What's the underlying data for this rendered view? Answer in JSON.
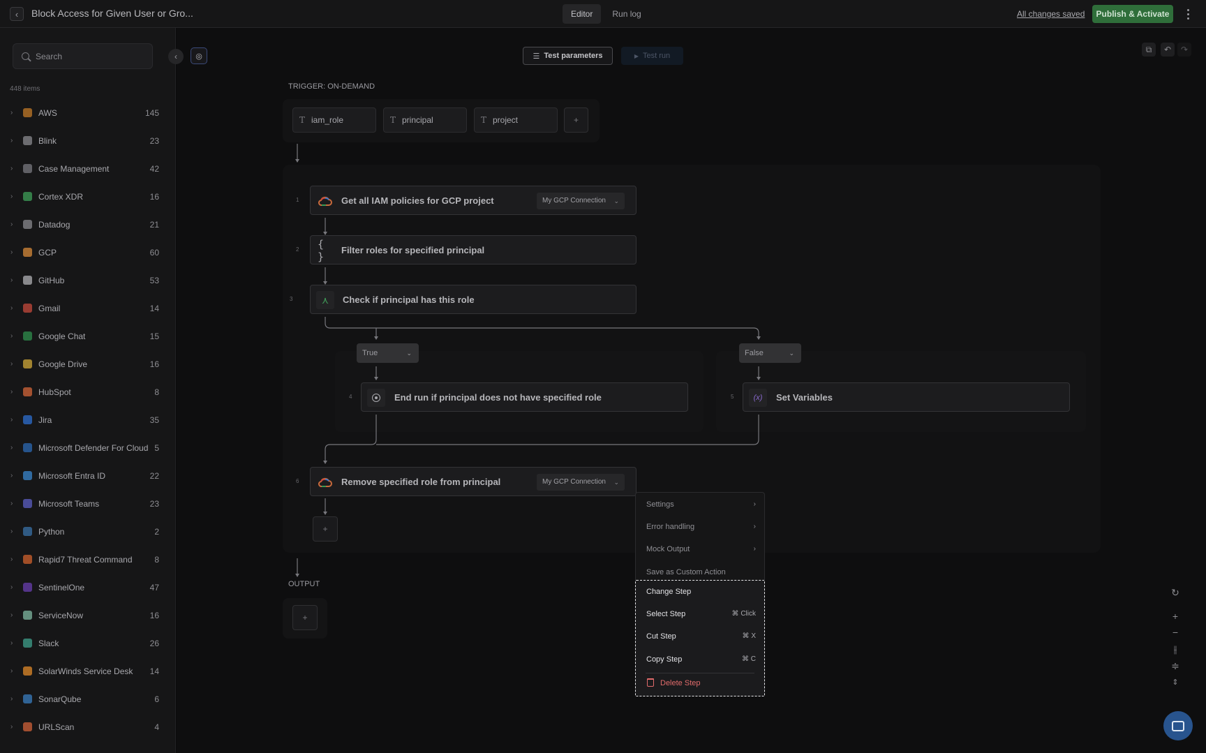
{
  "header": {
    "title": "Block Access for Given User or Gro...",
    "tabs": [
      {
        "label": "Editor"
      },
      {
        "label": "Run log"
      }
    ],
    "saved_text": "All changes saved",
    "publish_label": "Publish & Activate"
  },
  "sidebar": {
    "search_placeholder": "Search",
    "items_count": "448 items",
    "items": [
      {
        "label": "AWS",
        "count": "145",
        "color": "#c27a28"
      },
      {
        "label": "Blink",
        "count": "23",
        "color": "#8a8a8f"
      },
      {
        "label": "Case Management",
        "count": "42",
        "color": "#7a7a80"
      },
      {
        "label": "Cortex XDR",
        "count": "16",
        "color": "#3fa05a"
      },
      {
        "label": "Datadog",
        "count": "21",
        "color": "#8a8a8f"
      },
      {
        "label": "GCP",
        "count": "60",
        "color": "#d7893a"
      },
      {
        "label": "GitHub",
        "count": "53",
        "color": "#b0b0b4"
      },
      {
        "label": "Gmail",
        "count": "14",
        "color": "#c64a3c"
      },
      {
        "label": "Google Chat",
        "count": "15",
        "color": "#2f8f4e"
      },
      {
        "label": "Google Drive",
        "count": "16",
        "color": "#d0a83a"
      },
      {
        "label": "HubSpot",
        "count": "8",
        "color": "#d3663a"
      },
      {
        "label": "Jira",
        "count": "35",
        "color": "#2e6fd0"
      },
      {
        "label": "Microsoft Defender For Cloud",
        "count": "5",
        "color": "#2c6ab4"
      },
      {
        "label": "Microsoft Entra ID",
        "count": "22",
        "color": "#3a87cf"
      },
      {
        "label": "Microsoft Teams",
        "count": "23",
        "color": "#5c5fc4"
      },
      {
        "label": "Python",
        "count": "2",
        "color": "#3a72a8"
      },
      {
        "label": "Rapid7 Threat Command",
        "count": "8",
        "color": "#d0612e"
      },
      {
        "label": "SentinelOne",
        "count": "47",
        "color": "#6a3fb0"
      },
      {
        "label": "ServiceNow",
        "count": "16",
        "color": "#7fb8a2"
      },
      {
        "label": "Slack",
        "count": "26",
        "color": "#3fa08c"
      },
      {
        "label": "SolarWinds Service Desk",
        "count": "14",
        "color": "#e08a2a"
      },
      {
        "label": "SonarQube",
        "count": "6",
        "color": "#3a7ec0"
      },
      {
        "label": "URLScan",
        "count": "4",
        "color": "#d0613a"
      }
    ]
  },
  "canvas": {
    "test_params_label": "Test parameters",
    "test_run_label": "Test run",
    "trigger_label": "TRIGGER: ON-DEMAND",
    "params": [
      "iam_role",
      "principal",
      "project"
    ],
    "output_label": "OUTPUT",
    "steps": [
      {
        "num": "1",
        "title": "Get all IAM policies for GCP project",
        "connection": "My GCP Connection"
      },
      {
        "num": "2",
        "title": "Filter roles for specified principal"
      },
      {
        "num": "3",
        "title": "Check if principal has this role"
      },
      {
        "num": "4",
        "title": "End run if principal does not have specified role"
      },
      {
        "num": "5",
        "title": "Set Variables"
      },
      {
        "num": "6",
        "title": "Remove specified role from principal",
        "connection": "My GCP Connection"
      }
    ],
    "branches": {
      "true_label": "True",
      "false_label": "False"
    }
  },
  "context_menu": {
    "items": [
      {
        "label": "Settings",
        "shortcut": "›"
      },
      {
        "label": "Error handling",
        "shortcut": "›"
      },
      {
        "label": "Mock Output",
        "shortcut": "›"
      },
      {
        "label": "Save as Custom Action",
        "shortcut": ""
      },
      {
        "label": "Change Step",
        "shortcut": ""
      },
      {
        "label": "Select Step",
        "shortcut": "⌘ Click"
      },
      {
        "label": "Cut Step",
        "shortcut": "⌘ X"
      },
      {
        "label": "Copy Step",
        "shortcut": "⌘ C"
      },
      {
        "label": "Delete Step",
        "shortcut": ""
      }
    ]
  }
}
